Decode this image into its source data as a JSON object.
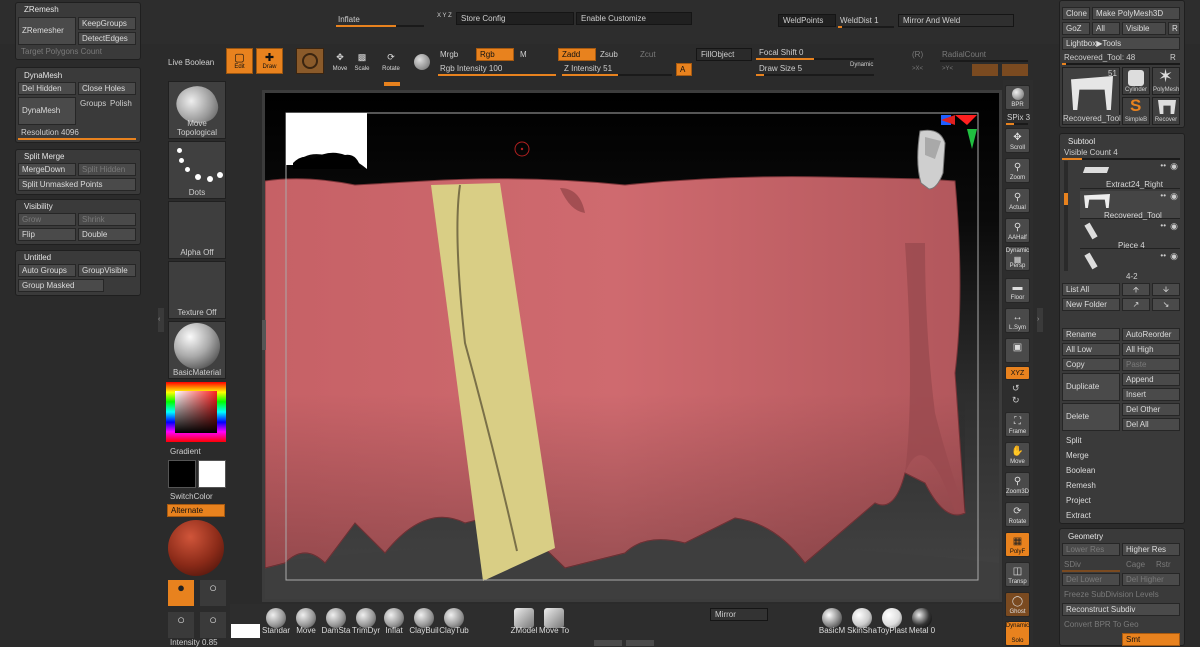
{
  "top_bar": {
    "inflate": "Inflate",
    "xyz": "X Y Z",
    "store_config": "Store Config",
    "enable_customize": "Enable Customize",
    "weld_points": "WeldPoints",
    "weld_dist": "WeldDist 1",
    "mirror_and_weld": "Mirror And Weld"
  },
  "toolbar": {
    "live_boolean": "Live Boolean",
    "edit": "Edit",
    "draw": "Draw",
    "move": "Move",
    "scale": "Scale",
    "rotate": "Rotate",
    "mrgb": "Mrgb",
    "rgb": "Rgb",
    "m": "M",
    "rgb_intensity": "Rgb Intensity 100",
    "zadd": "Zadd",
    "zsub": "Zsub",
    "zcut": "Zcut",
    "z_intensity": "Z Intensity 51",
    "a": "A",
    "fill_object": "FillObject",
    "focal_shift": "Focal Shift 0",
    "draw_size": "Draw Size 5",
    "dynamic": "Dynamic",
    "r1": "(R)",
    "radial_count": "RadialCount",
    "x_ctrl": ">X<",
    "y_ctrl": ">Y<"
  },
  "left": {
    "zremesh": {
      "title": "ZRemesh",
      "zremesher": "ZRemesher",
      "keep_groups": "KeepGroups",
      "detect_edges": "DetectEdges",
      "target_polygons": "Target Polygons Count"
    },
    "dynamesh": {
      "title": "DynaMesh",
      "del_hidden": "Del Hidden",
      "close_holes": "Close Holes",
      "dynamesh": "DynaMesh",
      "groups": "Groups",
      "polish": "Polish",
      "resolution": "Resolution 4096"
    },
    "split_merge": {
      "title": "Split Merge",
      "merge_down": "MergeDown",
      "split_hidden": "Split Hidden",
      "split_unmasked": "Split Unmasked Points"
    },
    "visibility": {
      "title": "Visibility",
      "grow": "Grow",
      "shrink": "Shrink",
      "flip": "Flip",
      "double": "Double"
    },
    "untitled": {
      "title": "Untitled",
      "auto_groups": "Auto Groups",
      "group_visible": "GroupVisible",
      "group_masked": "Group Masked"
    }
  },
  "tray": {
    "move_topological": "Move Topological",
    "dots": "Dots",
    "alpha_off": "Alpha Off",
    "texture_off": "Texture Off",
    "basic_material": "BasicMaterial",
    "gradient": "Gradient",
    "switch_color": "SwitchColor",
    "alternate": "Alternate",
    "intensity": "Intensity 0.85"
  },
  "right_shelf": {
    "bpr": "BPR",
    "spix": "SPix 3",
    "scroll": "Scroll",
    "zoom": "Zoom",
    "actual": "Actual",
    "aahalf": "AAHalf",
    "dynamic": "Dynamic",
    "persp": "Persp",
    "floor": "Floor",
    "lsym": "L.Sym",
    "xyz": "XYZ",
    "frame": "Frame",
    "move": "Move",
    "zoom3d": "Zoom3D",
    "rotate": "Rotate",
    "polyf": "PolyF",
    "transp": "Transp",
    "ghost": "Ghost",
    "solo": "Solo"
  },
  "tool_panel": {
    "clone": "Clone",
    "make_polymesh": "Make PolyMesh3D",
    "goz": "GoZ",
    "all": "All",
    "visible": "Visible",
    "r": "R",
    "lightbox_tools": "Lightbox▶Tools",
    "recovered_tool": "Recovered_Tool: 48",
    "r2": "R",
    "count_51": "51",
    "thumbs": [
      "Recovered_Tool",
      "Cylinder",
      "PolyMesh",
      "SimpleB",
      "Recover"
    ]
  },
  "subtool": {
    "title": "Subtool",
    "visible_count": "Visible Count 4",
    "items": [
      "Extract24_Right",
      "Recovered_Tool",
      "Piece 4"
    ],
    "pager": "4-2",
    "list_all": "List All",
    "new_folder": "New Folder",
    "rename": "Rename",
    "auto_reorder": "AutoReorder",
    "all_low": "All Low",
    "all_high": "All High",
    "copy": "Copy",
    "paste": "Paste",
    "append": "Append",
    "duplicate": "Duplicate",
    "insert": "Insert",
    "del_other": "Del Other",
    "delete": "Delete",
    "del_all": "Del All",
    "split": "Split",
    "merge": "Merge",
    "boolean": "Boolean",
    "remesh": "Remesh",
    "project": "Project",
    "extract": "Extract"
  },
  "geometry": {
    "title": "Geometry",
    "lower_res": "Lower Res",
    "higher_res": "Higher Res",
    "sdiv": "SDiv",
    "cage": "Cage",
    "rstr": "Rstr",
    "del_lower": "Del Lower",
    "del_higher": "Del Higher",
    "freeze": "Freeze SubDivision Levels",
    "reconstruct": "Reconstruct Subdiv",
    "convert_bpr": "Convert BPR To Geo",
    "smt": "Smt"
  },
  "bottom": {
    "brushes": [
      "Standar",
      "Move",
      "DamSta",
      "TrimDyr",
      "Inflat",
      "ClayBuil",
      "ClayTub"
    ],
    "zmodeler": "ZModel",
    "move_tool": "Move To",
    "mirror": "Mirror",
    "materials": [
      "BasicM",
      "SkinSha",
      "ToyPlast",
      "Metal 0"
    ]
  },
  "colors": {
    "accent": "#e8821e",
    "mesh": "#c86368",
    "stripe": "#d8cf86",
    "bg": "#2b2b2b"
  }
}
